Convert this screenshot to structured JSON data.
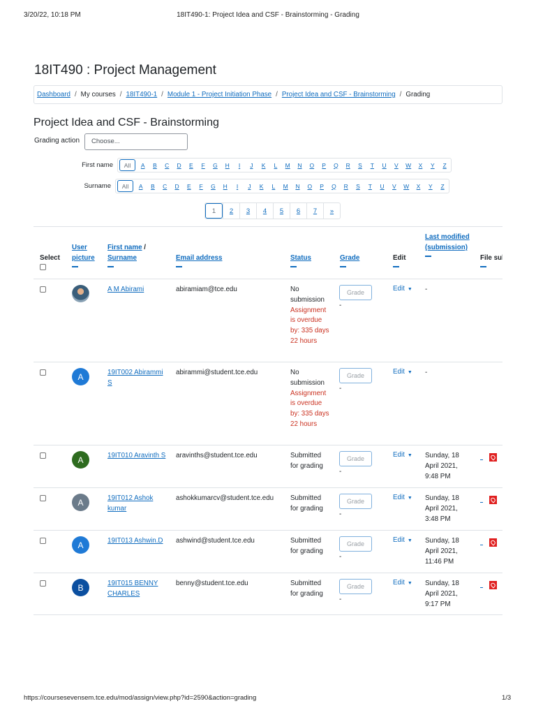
{
  "print_header": {
    "datetime": "3/20/22, 10:18 PM",
    "title": "18IT490-1: Project Idea and CSF - Brainstorming - Grading"
  },
  "course_title": "18IT490 : Project Management",
  "breadcrumb": [
    "Dashboard",
    "My courses",
    "18IT490-1",
    "Module 1 - Project Initiation Phase",
    "Project Idea and CSF - Brainstorming",
    "Grading"
  ],
  "assignment_title": "Project Idea and CSF - Brainstorming",
  "grading_action": {
    "label": "Grading action",
    "value": "Choose..."
  },
  "filters": {
    "firstname_label": "First name",
    "surname_label": "Surname",
    "all": "All",
    "letters": [
      "A",
      "B",
      "C",
      "D",
      "E",
      "F",
      "G",
      "H",
      "I",
      "J",
      "K",
      "L",
      "M",
      "N",
      "O",
      "P",
      "Q",
      "R",
      "S",
      "T",
      "U",
      "V",
      "W",
      "X",
      "Y",
      "Z"
    ]
  },
  "pagination": [
    "1",
    "2",
    "3",
    "4",
    "5",
    "6",
    "7",
    "»"
  ],
  "columns": {
    "select": "Select",
    "user_picture": "User picture",
    "first_name": "First name",
    "surname": "Surname",
    "email": "Email address",
    "status": "Status",
    "grade": "Grade",
    "edit": "Edit",
    "last_modified": "Last modified (submission)",
    "file": "File sul"
  },
  "rows": [
    {
      "name": "A M Abirami",
      "email": "abiramiam@tce.edu",
      "status": "No submission",
      "overdue": "Assignment is overdue by: 335 days 22 hours",
      "grade_placeholder": "Grade",
      "grade_value": "-",
      "edit": "Edit",
      "modified": "-",
      "avatar": "photo"
    },
    {
      "name": "19IT002 Abirammi S",
      "email": "abirammi@student.tce.edu",
      "status": "No submission",
      "overdue": "Assignment is overdue by: 335 days 22 hours",
      "grade_placeholder": "Grade",
      "grade_value": "-",
      "edit": "Edit",
      "modified": "-",
      "avatar": "A",
      "avatar_color": "#1f7ad6"
    },
    {
      "name": "19IT010 Aravinth S",
      "email": "aravinths@student.tce.edu",
      "status": "Submitted for grading",
      "grade_placeholder": "Grade",
      "grade_value": "-",
      "edit": "Edit",
      "modified": "Sunday, 18 April 2021, 9:48 PM",
      "avatar": "A",
      "avatar_color": "#2e6b1f",
      "file": "-"
    },
    {
      "name": "19IT012 Ashok kumar",
      "email": "ashokkumarcv@student.tce.edu",
      "status": "Submitted for grading",
      "grade_placeholder": "Grade",
      "grade_value": "-",
      "edit": "Edit",
      "modified": "Sunday, 18 April 2021, 3:48 PM",
      "avatar": "A",
      "avatar_color": "#6b7b8a",
      "file": "-"
    },
    {
      "name": "19IT013 Ashwin.D",
      "email": "ashwind@student.tce.edu",
      "status": "Submitted for grading",
      "grade_placeholder": "Grade",
      "grade_value": "-",
      "edit": "Edit",
      "modified": "Sunday, 18 April 2021, 11:46 PM",
      "avatar": "A",
      "avatar_color": "#1f7ad6",
      "file": "-"
    },
    {
      "name": "19IT015 BENNY CHARLES",
      "email": "benny@student.tce.edu",
      "status": "Submitted for grading",
      "grade_placeholder": "Grade",
      "grade_value": "-",
      "edit": "Edit",
      "modified": "Sunday, 18 April 2021, 9:17 PM",
      "avatar": "B",
      "avatar_color": "#0b4fa0",
      "file": "-"
    }
  ],
  "print_footer": {
    "url": "https://coursesevensem.tce.edu/mod/assign/view.php?id=2590&action=grading",
    "page": "1/3"
  },
  "colors": {
    "link": "#0f6cbf",
    "overdue": "#ca3120",
    "pdf": "#e02020"
  }
}
